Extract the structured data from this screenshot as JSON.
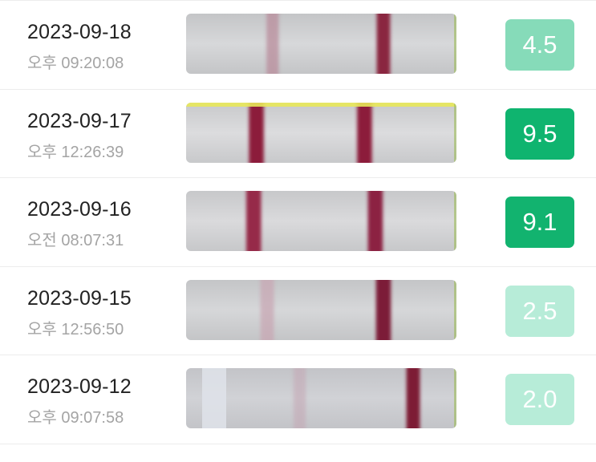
{
  "entries": [
    {
      "date": "2023-09-18",
      "time": "오후 09:20:08",
      "score": "4.5",
      "score_color": "#86dbb9",
      "strip": {
        "bg_from": "#c4c5c7",
        "bg_to": "#d7d8da",
        "lines": [
          {
            "pos": 0.32,
            "width": 0.045,
            "color": "#b98c9b",
            "opacity": 0.75
          },
          {
            "pos": 0.73,
            "width": 0.05,
            "color": "#8a2840",
            "opacity": 1
          }
        ],
        "yellow_edge": false
      }
    },
    {
      "date": "2023-09-17",
      "time": "오후 12:26:39",
      "score": "9.5",
      "score_color": "#0fb46f",
      "strip": {
        "bg_from": "#c8c9cb",
        "bg_to": "#dcdcde",
        "lines": [
          {
            "pos": 0.26,
            "width": 0.055,
            "color": "#8c1f3b",
            "opacity": 1
          },
          {
            "pos": 0.66,
            "width": 0.055,
            "color": "#8c1f3b",
            "opacity": 1
          }
        ],
        "yellow_edge": true
      }
    },
    {
      "date": "2023-09-16",
      "time": "오전 08:07:31",
      "score": "9.1",
      "score_color": "#12b36f",
      "strip": {
        "bg_from": "#c7c8ca",
        "bg_to": "#dadadc",
        "lines": [
          {
            "pos": 0.25,
            "width": 0.055,
            "color": "#962a48",
            "opacity": 1
          },
          {
            "pos": 0.7,
            "width": 0.055,
            "color": "#8c2442",
            "opacity": 1
          }
        ],
        "yellow_edge": false
      }
    },
    {
      "date": "2023-09-15",
      "time": "오후 12:56:50",
      "score": "2.5",
      "score_color": "#b7ecd8",
      "strip": {
        "bg_from": "#c4c5c7",
        "bg_to": "#d6d7d9",
        "lines": [
          {
            "pos": 0.3,
            "width": 0.05,
            "color": "#c8a5b2",
            "opacity": 0.7
          },
          {
            "pos": 0.73,
            "width": 0.055,
            "color": "#7c1f37",
            "opacity": 1
          }
        ],
        "yellow_edge": false
      }
    },
    {
      "date": "2023-09-12",
      "time": "오후 09:07:58",
      "score": "2.0",
      "score_color": "#b7ecd8",
      "strip": {
        "bg_from": "#c3c4c8",
        "bg_to": "#d1d2d6",
        "lines": [
          {
            "pos": 0.42,
            "width": 0.045,
            "color": "#c4a9b6",
            "opacity": 0.6
          },
          {
            "pos": 0.84,
            "width": 0.05,
            "color": "#7d1d36",
            "opacity": 1
          }
        ],
        "yellow_edge": false
      }
    }
  ]
}
